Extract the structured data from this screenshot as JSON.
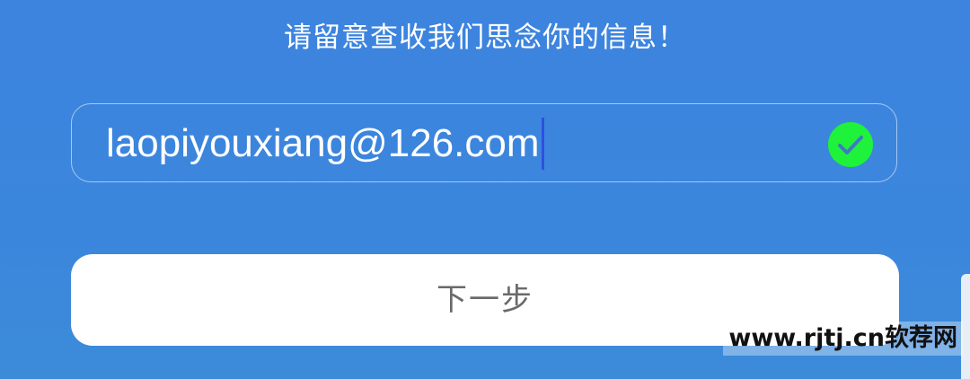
{
  "subtitle": "请留意查收我们思念你的信息！",
  "email_input": {
    "value": "laopiyouxiang@126.com",
    "status_icon": "check-circle-icon",
    "status_color": "#1ef23a"
  },
  "next_button": {
    "label": "下一步"
  },
  "watermark": "www.rjtj.cn软荐网",
  "colors": {
    "background": "#3d84de",
    "button_bg": "#ffffff",
    "button_text": "#6a6a6a",
    "caret": "#2f4fe0"
  }
}
